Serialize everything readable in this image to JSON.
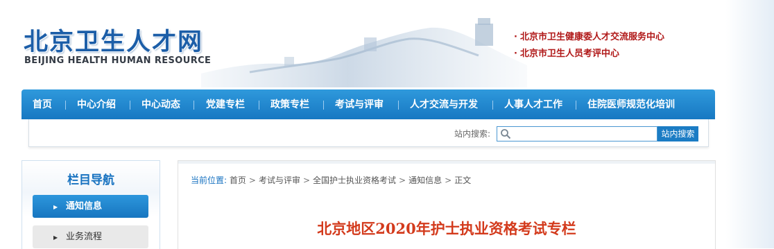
{
  "site": {
    "logo_cn": "北京卫生人才网",
    "logo_en": "BEIJING HEALTH HUMAN RESOURCE",
    "header_links": [
      {
        "bullet": "·",
        "label": "北京市卫生健康委人才交流服务中心"
      },
      {
        "bullet": "·",
        "label": "北京市卫生人员考评中心"
      }
    ]
  },
  "nav": {
    "items": [
      "首页",
      "中心介绍",
      "中心动态",
      "党建专栏",
      "政策专栏",
      "考试与评审",
      "人才交流与开发",
      "人事人才工作",
      "住院医师规范化培训"
    ]
  },
  "search": {
    "label": "站内搜索:",
    "placeholder": "",
    "value": "",
    "button_label": "站内搜索",
    "icon": "search-icon"
  },
  "sidebar": {
    "title": "栏目导航",
    "items": [
      {
        "label": "通知信息",
        "active": true
      },
      {
        "label": "业务流程",
        "active": false
      }
    ]
  },
  "breadcrumb": {
    "prefix": "当前位置:",
    "items": [
      "首页",
      "考试与评审",
      "全国护士执业资格考试",
      "通知信息",
      "正文"
    ],
    "separator": ">"
  },
  "article": {
    "title": "北京地区2020年护士执业资格考试专栏"
  },
  "colors": {
    "brand_blue": "#1c5ea8",
    "nav_blue": "#1f86cf",
    "header_link_red": "#b01818",
    "title_red": "#d33a1c"
  }
}
